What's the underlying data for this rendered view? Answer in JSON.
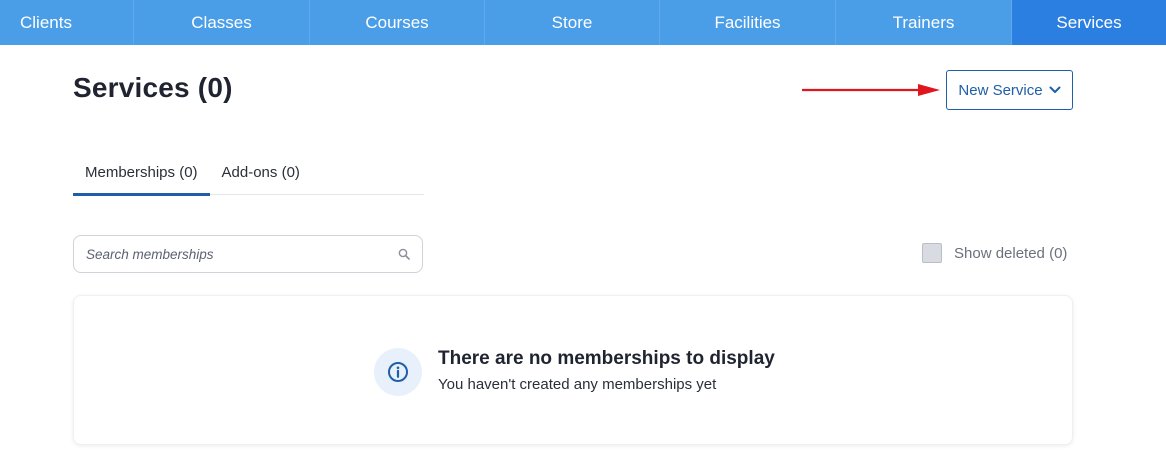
{
  "nav": {
    "items": [
      {
        "label": "Clients"
      },
      {
        "label": "Classes"
      },
      {
        "label": "Courses"
      },
      {
        "label": "Store"
      },
      {
        "label": "Facilities"
      },
      {
        "label": "Trainers"
      },
      {
        "label": "Services"
      }
    ],
    "active": "Services"
  },
  "header": {
    "title": "Services (0)",
    "new_service_label": "New Service"
  },
  "tabs": [
    {
      "label": "Memberships (0)"
    },
    {
      "label": "Add-ons (0)"
    }
  ],
  "search": {
    "placeholder": "Search memberships",
    "value": ""
  },
  "show_deleted": {
    "label": "Show deleted (0)",
    "checked": false
  },
  "empty_state": {
    "title": "There are no memberships to display",
    "subtitle": "You haven't created any memberships yet"
  },
  "colors": {
    "nav_bg": "#4a9ee8",
    "nav_active": "#2b7fe0",
    "accent": "#1e5fa8",
    "annotation_arrow": "#e0161e"
  },
  "icons": {
    "new_service_chevron": "chevron-down-icon",
    "search": "search-icon",
    "empty_state": "info-icon",
    "annotation": "arrow-right-icon"
  }
}
